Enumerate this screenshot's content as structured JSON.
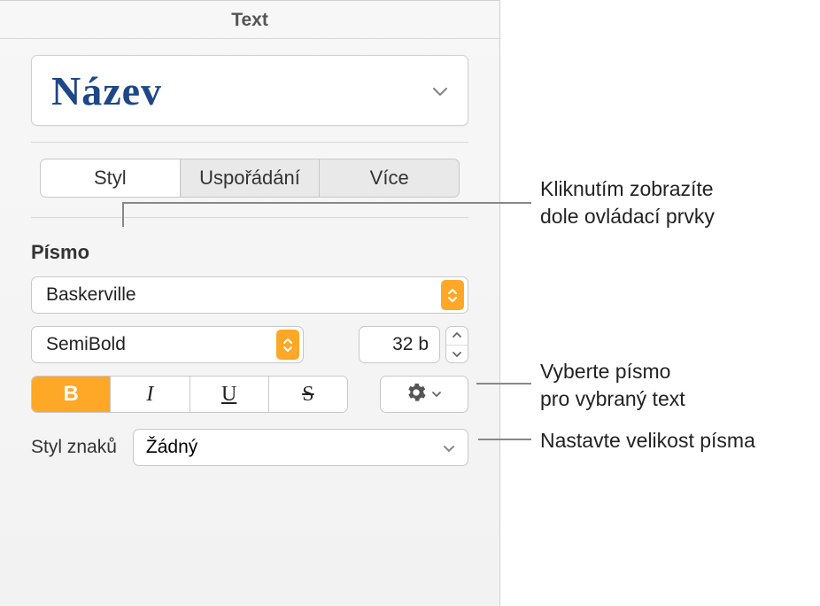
{
  "header": {
    "tab": "Text"
  },
  "paragraphStyle": {
    "name": "Název"
  },
  "tabs": {
    "style": "Styl",
    "layout": "Uspořádání",
    "more": "Více"
  },
  "font": {
    "sectionLabel": "Písmo",
    "family": "Baskerville",
    "weight": "SemiBold",
    "size": "32 b",
    "glyphs": {
      "bold": "B",
      "italic": "I",
      "underline": "U",
      "strike": "S"
    }
  },
  "charStyle": {
    "label": "Styl znaků",
    "value": "Žádný"
  },
  "callouts": {
    "tabs": "Kliknutím zobrazíte\ndole ovládací prvky",
    "family": "Vyberte písmo\npro vybraný text",
    "size": "Nastavte velikost písma"
  }
}
